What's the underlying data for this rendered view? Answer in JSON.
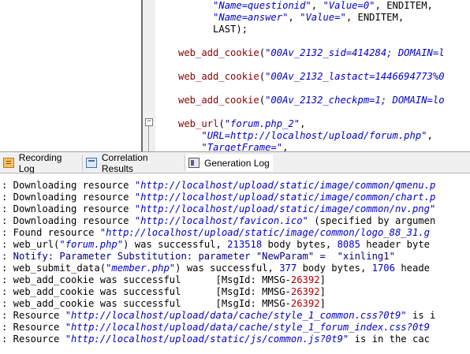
{
  "script_editor": {
    "lines": [
      [
        {
          "t": "      ",
          "c": "p"
        },
        {
          "t": "\"Name=questionid\"",
          "c": "str"
        },
        {
          "t": ", ",
          "c": "p"
        },
        {
          "t": "\"Value=0\"",
          "c": "str"
        },
        {
          "t": ", ENDITEM,",
          "c": "p"
        }
      ],
      [
        {
          "t": "      ",
          "c": "p"
        },
        {
          "t": "\"Name=answer\"",
          "c": "str"
        },
        {
          "t": ", ",
          "c": "p"
        },
        {
          "t": "\"Value=\"",
          "c": "str"
        },
        {
          "t": ", ENDITEM,",
          "c": "p"
        }
      ],
      [
        {
          "t": "      LAST);",
          "c": "p"
        }
      ],
      [
        {
          "t": "",
          "c": "p"
        }
      ],
      [
        {
          "t": "web_add_cookie",
          "c": "fn"
        },
        {
          "t": "(",
          "c": "p"
        },
        {
          "t": "\"00Av_2132_sid=414284; DOMAIN=l",
          "c": "str"
        }
      ],
      [
        {
          "t": "",
          "c": "p"
        }
      ],
      [
        {
          "t": "web_add_cookie",
          "c": "fn"
        },
        {
          "t": "(",
          "c": "p"
        },
        {
          "t": "\"00Av_2132_lastact=1446694773%0",
          "c": "str"
        }
      ],
      [
        {
          "t": "",
          "c": "p"
        }
      ],
      [
        {
          "t": "web_add_cookie",
          "c": "fn"
        },
        {
          "t": "(",
          "c": "p"
        },
        {
          "t": "\"00Av_2132_checkpm=1; DOMAIN=lo",
          "c": "str"
        }
      ],
      [
        {
          "t": "",
          "c": "p"
        }
      ],
      [
        {
          "t": "web_url",
          "c": "fn"
        },
        {
          "t": "(",
          "c": "p"
        },
        {
          "t": "\"forum.php_2\"",
          "c": "str"
        },
        {
          "t": ",",
          "c": "p"
        }
      ],
      [
        {
          "t": "    ",
          "c": "p"
        },
        {
          "t": "\"URL=http://localhost/upload/forum.php\"",
          "c": "str"
        },
        {
          "t": ",",
          "c": "p"
        }
      ],
      [
        {
          "t": "    ",
          "c": "p"
        },
        {
          "t": "\"TargetFrame=\"",
          "c": "str"
        },
        {
          "t": ",",
          "c": "p"
        }
      ]
    ]
  },
  "tabs": [
    {
      "label": "Recording Log",
      "icon": "recording-log-icon"
    },
    {
      "label": "Correlation Results",
      "icon": "correlation-results-icon"
    },
    {
      "label": "Generation Log",
      "icon": "generation-log-icon"
    }
  ],
  "active_tab": "Generation Log",
  "output_log": {
    "lines": [
      [
        {
          "t": ": Downloading resource ",
          "c": "dark"
        },
        {
          "t": "\"http://localhost/upload/static/image/common/qmenu.p",
          "c": "str"
        }
      ],
      [
        {
          "t": ": Downloading resource ",
          "c": "dark"
        },
        {
          "t": "\"http://localhost/upload/static/image/common/chart.p",
          "c": "str"
        }
      ],
      [
        {
          "t": ": Downloading resource ",
          "c": "dark"
        },
        {
          "t": "\"http://localhost/upload/static/image/common/nv.png\"",
          "c": "str"
        }
      ],
      [
        {
          "t": ": Downloading resource ",
          "c": "dark"
        },
        {
          "t": "\"http://localhost/favicon.ico\"",
          "c": "str"
        },
        {
          "t": " (specified by argumen",
          "c": "dark"
        }
      ],
      [
        {
          "t": ": Found resource ",
          "c": "dark"
        },
        {
          "t": "\"http://localhost/upload/static/image/common/logo_88_31.g",
          "c": "str"
        }
      ],
      [
        {
          "t": ": web_url(",
          "c": "dark"
        },
        {
          "t": "\"forum.php\"",
          "c": "str"
        },
        {
          "t": ") was successful, ",
          "c": "dark"
        },
        {
          "t": "213518",
          "c": "num"
        },
        {
          "t": " body bytes, ",
          "c": "dark"
        },
        {
          "t": "8085",
          "c": "num"
        },
        {
          "t": " header byte",
          "c": "dark"
        }
      ],
      [
        {
          "t": ": Notify: Parameter Substitution: parameter \"NewParam\" =  \"xinling1\"",
          "c": "notify"
        }
      ],
      [
        {
          "t": ": web_submit_data(",
          "c": "dark"
        },
        {
          "t": "\"member.php\"",
          "c": "str"
        },
        {
          "t": ") was successful, ",
          "c": "dark"
        },
        {
          "t": "377",
          "c": "num"
        },
        {
          "t": " body bytes, ",
          "c": "dark"
        },
        {
          "t": "1706",
          "c": "num"
        },
        {
          "t": " heade",
          "c": "dark"
        }
      ],
      [
        {
          "t": ": web_add_cookie was successful      [MsgId: MMSG-",
          "c": "dark"
        },
        {
          "t": "26392",
          "c": "red"
        },
        {
          "t": "]",
          "c": "dark"
        }
      ],
      [
        {
          "t": ": web_add_cookie was successful      [MsgId: MMSG-",
          "c": "dark"
        },
        {
          "t": "26392",
          "c": "red"
        },
        {
          "t": "]",
          "c": "dark"
        }
      ],
      [
        {
          "t": ": web_add_cookie was successful      [MsgId: MMSG-",
          "c": "dark"
        },
        {
          "t": "26392",
          "c": "red"
        },
        {
          "t": "]",
          "c": "dark"
        }
      ],
      [
        {
          "t": ": Resource ",
          "c": "dark"
        },
        {
          "t": "\"http://localhost/upload/data/cache/style_1_common.css?0t9\"",
          "c": "str"
        },
        {
          "t": " is i",
          "c": "dark"
        }
      ],
      [
        {
          "t": ": Resource ",
          "c": "dark"
        },
        {
          "t": "\"http://localhost/upload/data/cache/style_1_forum_index.css?0t9",
          "c": "str"
        }
      ],
      [
        {
          "t": ": Resource ",
          "c": "dark"
        },
        {
          "t": "\"http://localhost/upload/static/js/common.js?0t9\"",
          "c": "str"
        },
        {
          "t": " is in the cac",
          "c": "dark"
        }
      ]
    ]
  },
  "colors": {
    "function": "#8b0000",
    "string": "#0000cd",
    "keyword": "#000080",
    "message_id": "#b00000",
    "notify": "#000080"
  }
}
